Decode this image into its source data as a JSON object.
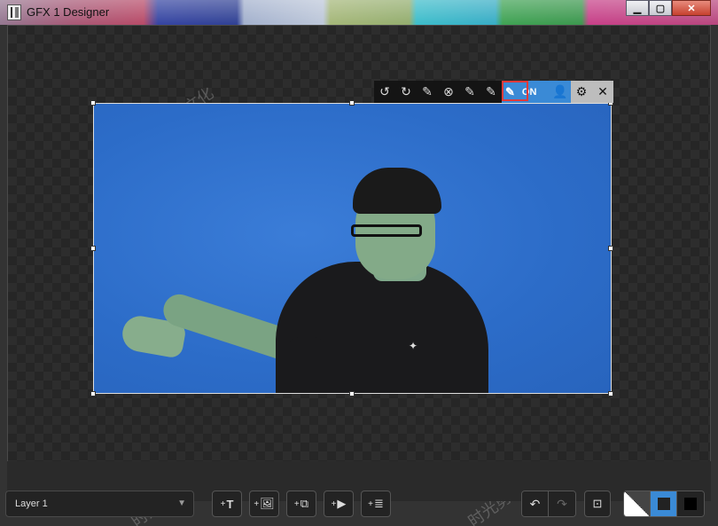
{
  "window": {
    "title": "GFX 1 Designer",
    "min": "▁",
    "max": "▢",
    "close": "✕"
  },
  "toolbar": {
    "items": [
      {
        "name": "rotate-left-icon",
        "glyph": "↺"
      },
      {
        "name": "rotate-right-icon",
        "glyph": "↻"
      },
      {
        "name": "pen-icon",
        "glyph": "✎"
      },
      {
        "name": "remove-icon",
        "glyph": "⊗"
      },
      {
        "name": "pen-minus-icon",
        "glyph": "✎"
      },
      {
        "name": "pen-plus-icon",
        "glyph": "✎"
      }
    ],
    "chroma_label": "ON",
    "user_glyph": "👤",
    "settings_glyph": "⚙",
    "close_glyph": "✕"
  },
  "watermark": "时光剪影文化",
  "bottom": {
    "layer_select": "Layer 1",
    "add_text": "T",
    "add_image": "🖼",
    "add_gallery": "⧉",
    "add_video": "▶",
    "add_list": "≣",
    "plus": "+",
    "undo": "↶",
    "redo": "↷",
    "fit": "⊡"
  }
}
